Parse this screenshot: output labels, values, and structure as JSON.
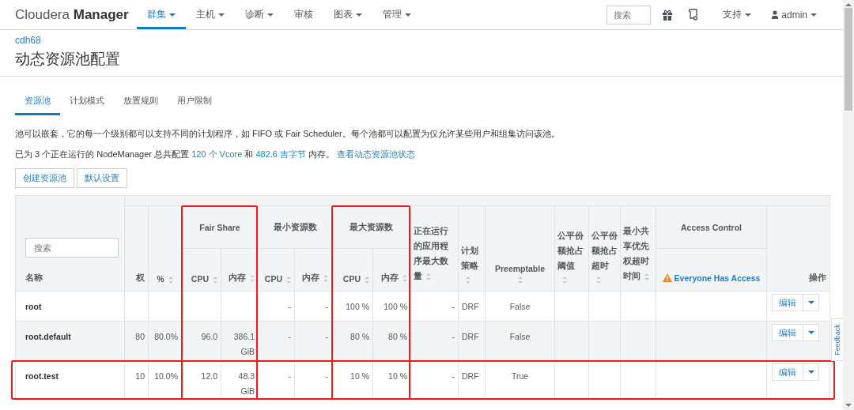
{
  "nav": {
    "brand_light": "Cloudera",
    "brand_bold": "Manager",
    "menu": [
      {
        "label": "群集",
        "selected": true,
        "caret": true
      },
      {
        "label": "主机",
        "selected": false,
        "caret": true
      },
      {
        "label": "诊断",
        "selected": false,
        "caret": true
      },
      {
        "label": "审核",
        "selected": false,
        "caret": false
      },
      {
        "label": "图表",
        "selected": false,
        "caret": true
      },
      {
        "label": "管理",
        "selected": false,
        "caret": true
      }
    ],
    "search_placeholder": "搜索",
    "support": "支持",
    "user": "admin"
  },
  "breadcrumb": "cdh68",
  "title": "动态资源池配置",
  "tabs": [
    {
      "label": "资源池",
      "selected": true
    },
    {
      "label": "计划模式",
      "selected": false
    },
    {
      "label": "放置规则",
      "selected": false
    },
    {
      "label": "用户限制",
      "selected": false
    }
  ],
  "description": "池可以嵌套，它的每一个级别都可以支持不同的计划程序，如 FIFO 或 Fair Scheduler。每个池都可以配置为仅允许某些用户和组集访问该池。",
  "summary": [
    {
      "kind": "text",
      "text": "已为 3 个正在运行的 NodeManager 总共配置 "
    },
    {
      "kind": "link",
      "text": "120 个 Vcore"
    },
    {
      "kind": "text",
      "text": " 和 "
    },
    {
      "kind": "link",
      "text": "482.6 吉字节"
    },
    {
      "kind": "text",
      "text": " 内存。 "
    },
    {
      "kind": "link",
      "text": "查看动态资源池状态"
    }
  ],
  "buttons": [
    "创建资源池",
    "默认设置"
  ],
  "table": {
    "search_placeholder": "搜索",
    "name_header": "名称",
    "weight_header": "权",
    "percent_header": "%",
    "groups": [
      {
        "label": "Fair Share",
        "highlighted": true,
        "sub": [
          "CPU",
          "内存"
        ]
      },
      {
        "label": "最小资源数",
        "highlighted": false,
        "sub": [
          "CPU",
          "内存"
        ]
      },
      {
        "label": "最大资源数",
        "highlighted": true,
        "sub": [
          "CPU",
          "内存"
        ]
      }
    ],
    "max_apps_header": "正在运行的应用程序最大数量",
    "policy_header": "计划策略",
    "preemptable_header": "Preemptable",
    "extra_headers": [
      "公平份额抢占阈值",
      "公平份额抢占超时",
      "最小共享优先权超时时间"
    ],
    "access_header": "Access Control",
    "access_link": "Everyone Has Access",
    "actions_header": "操作",
    "rows": [
      {
        "name": "root",
        "weight": "",
        "percent": "",
        "fair_cpu": "",
        "fair_mem": "",
        "min_cpu": "-",
        "min_mem": "-",
        "max_cpu": "100 %",
        "max_mem": "100 %",
        "max_apps": "-",
        "policy": "DRF",
        "preemptable": "False",
        "highlighted": false,
        "action": "编辑"
      },
      {
        "name": "root.default",
        "weight": "80",
        "percent": "80.0%",
        "fair_cpu": "96.0",
        "fair_mem": "386.1 GiB",
        "min_cpu": "-",
        "min_mem": "-",
        "max_cpu": "80 %",
        "max_mem": "80 %",
        "max_apps": "-",
        "policy": "DRF",
        "preemptable": "False",
        "highlighted": false,
        "action": "编辑"
      },
      {
        "name": "root.test",
        "weight": "10",
        "percent": "10.0%",
        "fair_cpu": "12.0",
        "fair_mem": "48.3 GiB",
        "min_cpu": "-",
        "min_mem": "-",
        "max_cpu": "10 %",
        "max_mem": "10 %",
        "max_apps": "-",
        "policy": "DRF",
        "preemptable": "True",
        "highlighted": true,
        "action": "编辑"
      }
    ]
  },
  "feedback": "Feedback"
}
